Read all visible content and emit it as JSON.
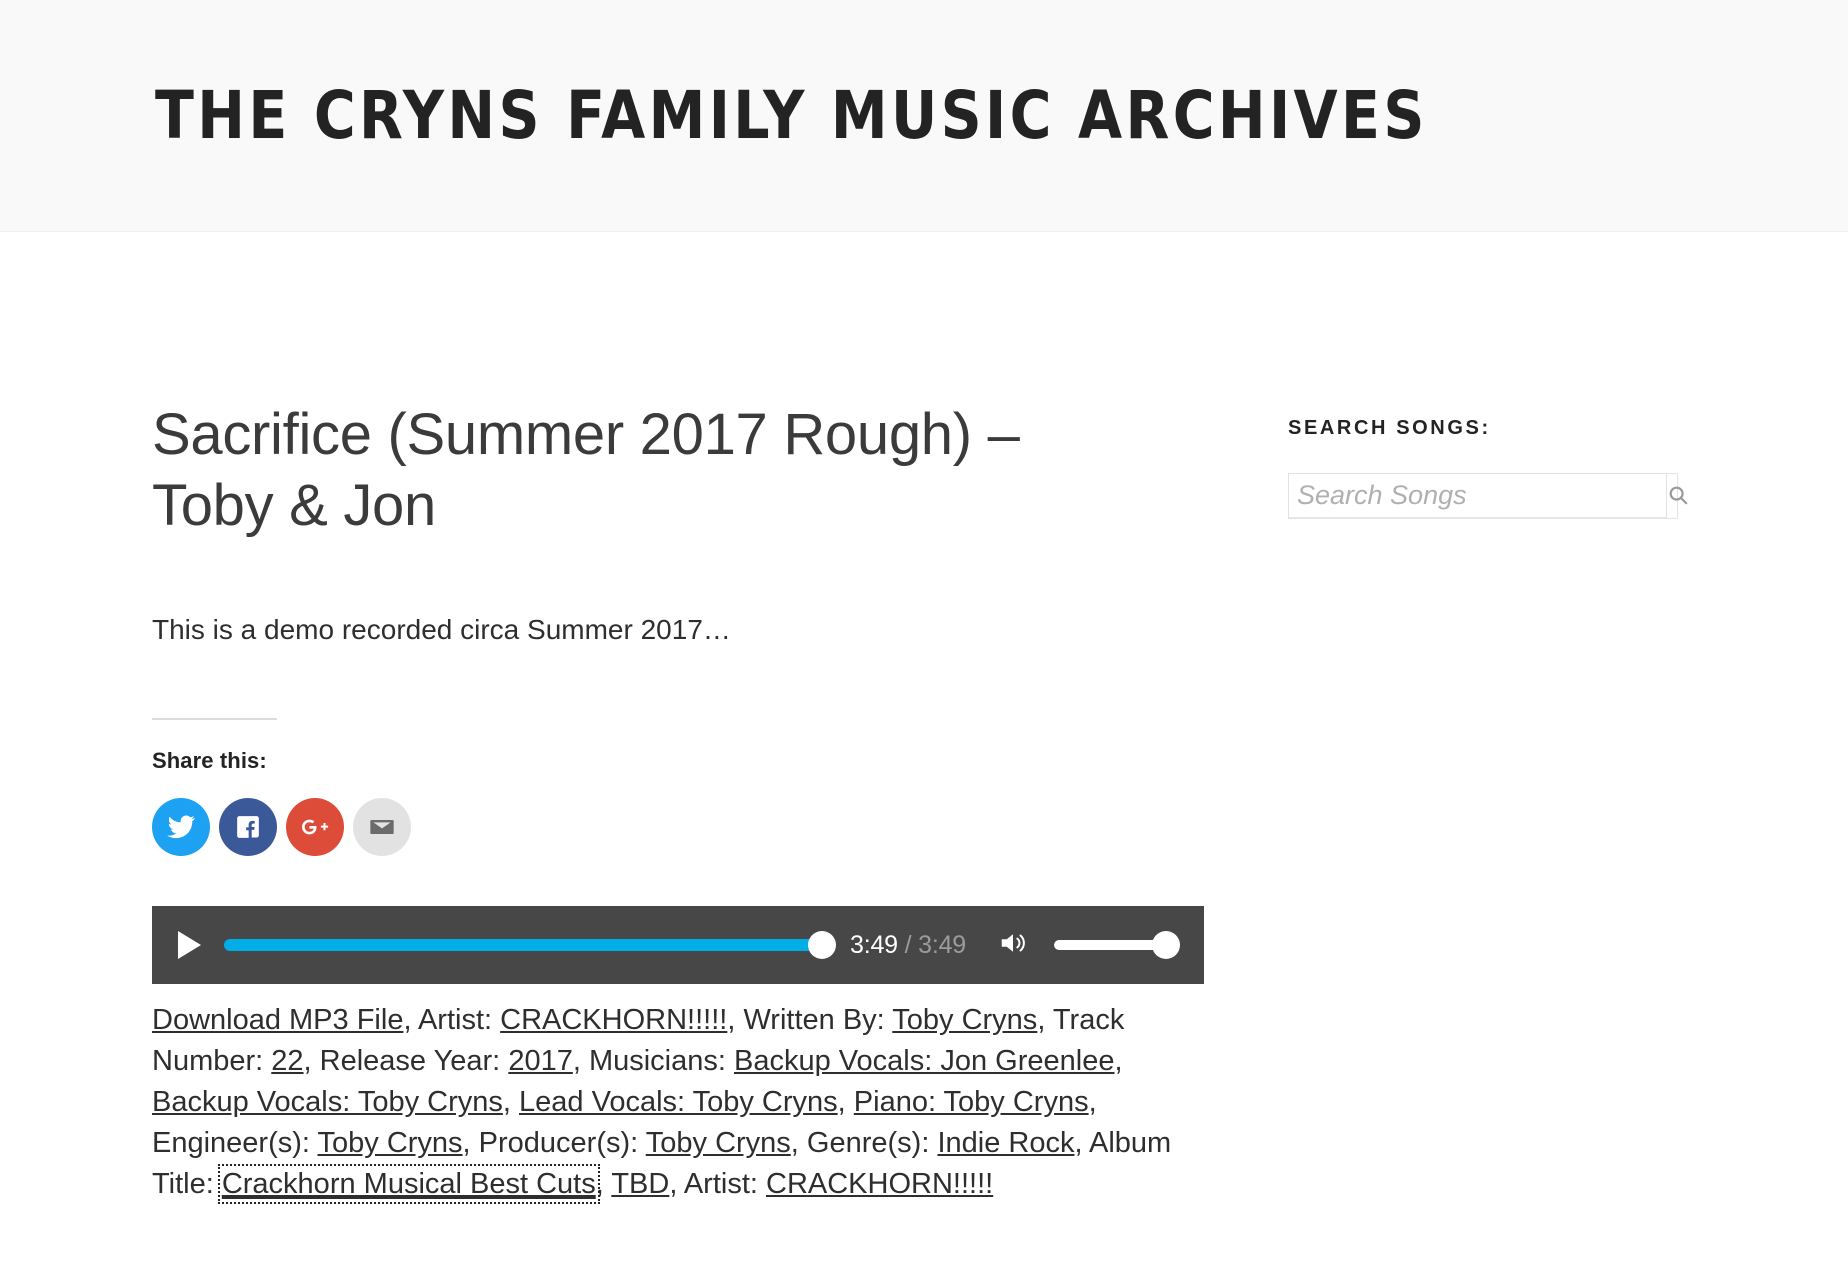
{
  "header": {
    "site_title": "THE CRYNS FAMILY MUSIC ARCHIVES"
  },
  "main": {
    "entry_title": "Sacrifice (Summer 2017 Rough) – Toby & Jon",
    "entry_description": "This is a demo recorded circa Summer 2017…",
    "share": {
      "label": "Share this:",
      "buttons": [
        {
          "name": "twitter",
          "icon": "twitter-icon",
          "color": "#1da1f2"
        },
        {
          "name": "facebook",
          "icon": "facebook-icon",
          "color": "#3b5998"
        },
        {
          "name": "google-plus",
          "icon": "google-plus-icon",
          "color": "#dd4b39"
        },
        {
          "name": "email",
          "icon": "email-icon",
          "color": "#e2e2e2"
        }
      ]
    },
    "player": {
      "play_icon": "play-icon",
      "volume_icon": "volume-high-icon",
      "current_time": "3:49",
      "total_time": "3:49",
      "time_separator": " / ",
      "progress_percent": 100,
      "volume_percent": 100,
      "progress_color": "#00ade6",
      "background_color": "#474747"
    },
    "metadata": {
      "download_link": "Download MP3 File",
      "sep": ", ",
      "artist_label": "Artist: ",
      "artist_value": "CRACKHORN!!!!!",
      "written_by_label": "Written By: ",
      "written_by_value": "Toby Cryns",
      "track_number_label": "Track Number: ",
      "track_number_value": "22",
      "release_year_label": "Release Year: ",
      "release_year_value": "2017",
      "musicians_label": "Musicians: ",
      "musician_1": "Backup Vocals: Jon Greenlee",
      "musician_2": "Backup Vocals: Toby Cryns",
      "musician_3": "Lead Vocals: Toby Cryns",
      "musician_4": "Piano: Toby Cryns",
      "engineers_label": "Engineer(s): ",
      "engineers_value": "Toby Cryns",
      "producers_label": "Producer(s): ",
      "producers_value": "Toby Cryns",
      "genres_label": "Genre(s): ",
      "genres_value": "Indie Rock",
      "album_title_label": "Album Title: ",
      "album_title_value": "Crackhorn Musical Best Cuts",
      "album_title_value_2": "TBD",
      "artist_label_2": "Artist: ",
      "artist_value_2": "CRACKHORN!!!!!"
    }
  },
  "sidebar": {
    "search_widget": {
      "title": "SEARCH SONGS:",
      "placeholder": "Search Songs",
      "value": "",
      "submit_icon": "search-icon"
    }
  }
}
